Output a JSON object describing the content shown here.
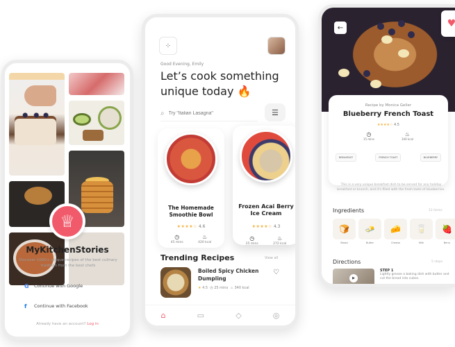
{
  "screen1": {
    "app_name": "MyKitchenStories",
    "description": "Discover 1000+ unique recipes of the best culinary tradition from the best chefs",
    "google_button": "Continue with Google",
    "facebook_button": "Continue with Facebook",
    "signup_prompt": "Already have an account?",
    "login_link": "Log in",
    "icons": [
      "chef-hat-icon",
      "google-icon",
      "facebook-icon"
    ]
  },
  "screen2": {
    "greeting": "Good Evening, Emily",
    "headline": "Let’s cook something unique today 🔥",
    "search_placeholder": "Try \"Italian Lasagna\"",
    "featured": [
      {
        "name": "The Homemade Smoothie Bowl",
        "stars": "★★★★☆",
        "rating": "4.6",
        "time": "45 mins",
        "kcal": "420 kcal"
      },
      {
        "name": "Frozen Acai Berry Ice Cream",
        "stars": "★★★★☆",
        "rating": "4.3",
        "time": "25 mins",
        "kcal": "272 kcal"
      }
    ],
    "trending_title": "Trending Recipes",
    "view_all": "View all",
    "trending_item": {
      "name": "Boiled Spicy Chicken Dumpling",
      "stars": "★",
      "rating": "4.5",
      "time": "25 mins",
      "kcal": "340 kcal"
    },
    "tabs": [
      "home-icon",
      "chat-icon",
      "tag-icon",
      "profile-icon"
    ]
  },
  "screen3": {
    "byline": "Recipe by Monica Geller",
    "title": "Blueberry French Toast",
    "stars": "★★★★☆",
    "rating": "4.5",
    "time": "15 mins",
    "kcal": "340 kcal",
    "tags": [
      "BREAKFAST",
      "FRENCH TOAST",
      "BLUEBERRY"
    ],
    "description": "This is a very unique breakfast dish to be served for any holiday breakfast or brunch, and it's filled with the fresh taste of blueberries.",
    "ingredients_title": "Ingredients",
    "ingredients_count": "12 items",
    "ingredients": [
      {
        "name": "Bread",
        "icon": "🍞"
      },
      {
        "name": "Butter",
        "icon": "🧈"
      },
      {
        "name": "Cheese",
        "icon": "🧀"
      },
      {
        "name": "Milk",
        "icon": "🥛"
      },
      {
        "name": "Berry",
        "icon": "🍓"
      }
    ],
    "directions_title": "Directions",
    "directions_count": "5 steps",
    "step_label": "STEP 1",
    "step_text": "Lightly grease a baking dish with butter and cut the bread into cubes.",
    "accent_color": "#f15a6a",
    "star_color": "#f4b13b"
  }
}
